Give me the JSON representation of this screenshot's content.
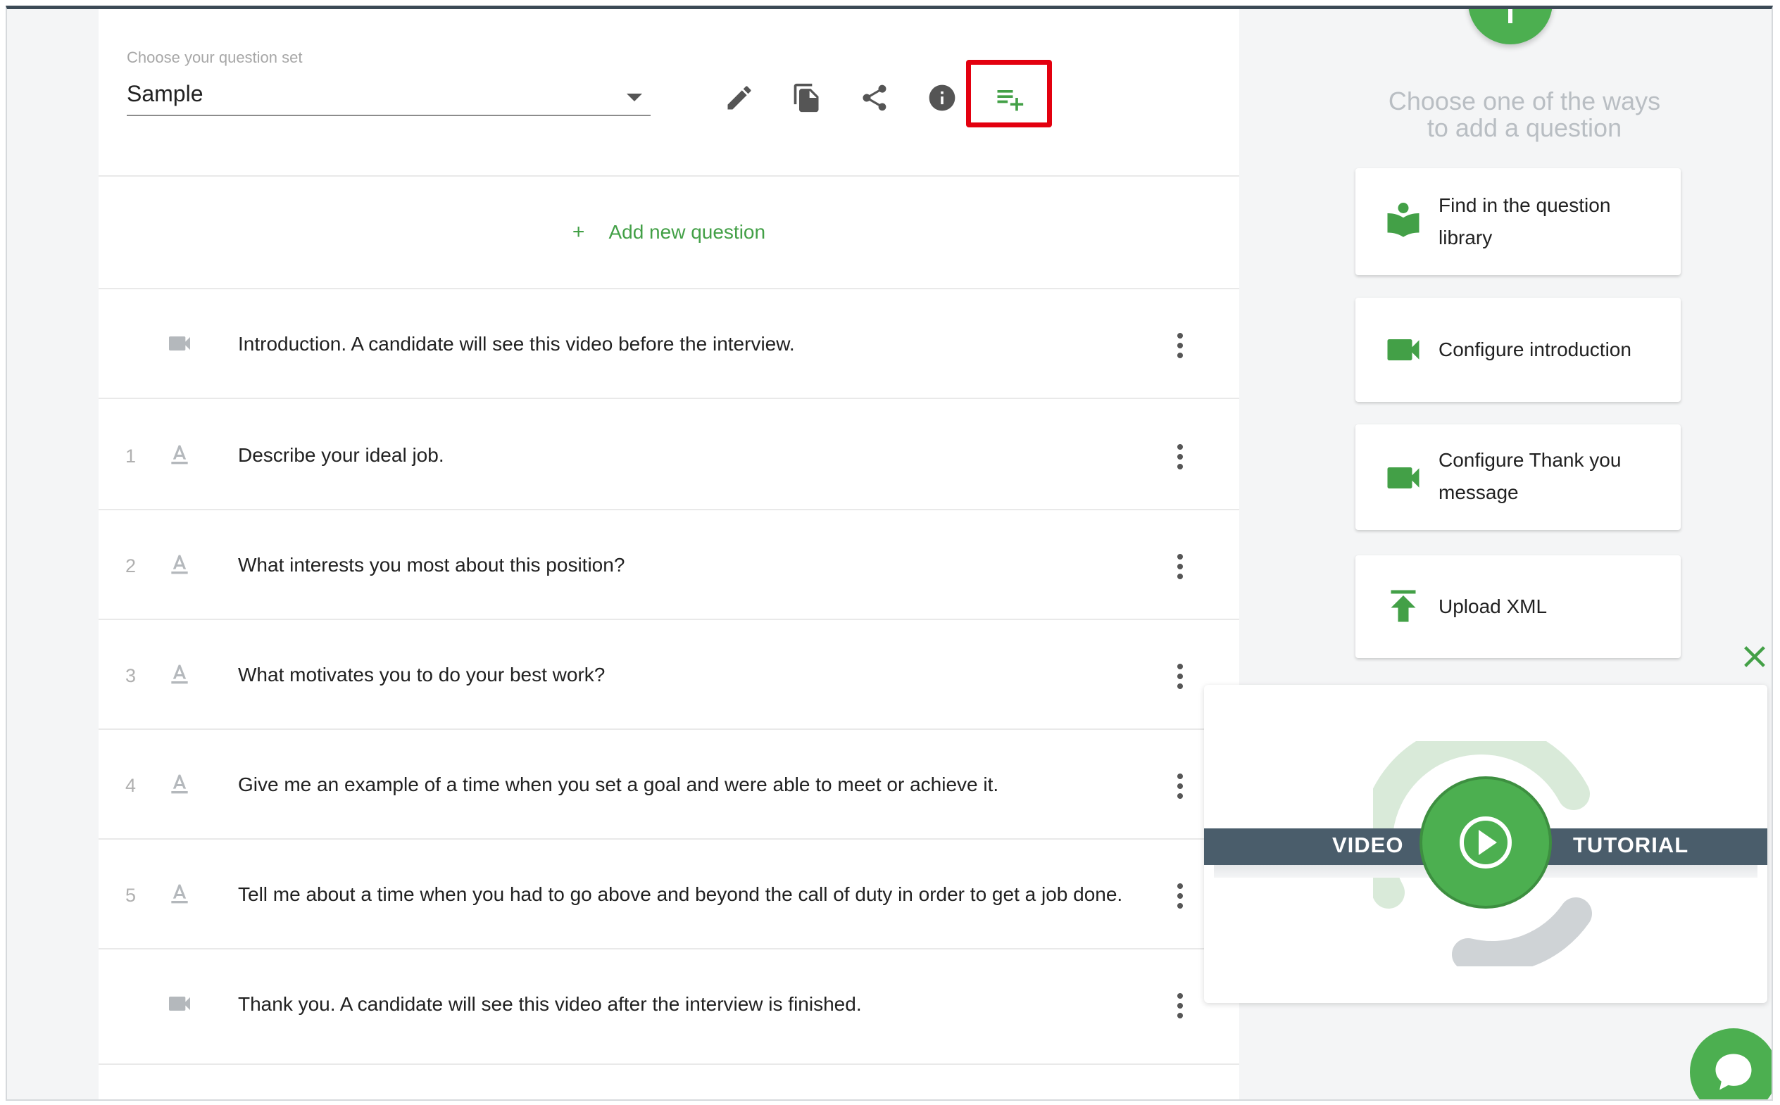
{
  "question_set": {
    "label": "Choose your question set",
    "selected": "Sample"
  },
  "toolbar": {
    "edit_icon": "pencil-icon",
    "copy_icon": "copy-icon",
    "share_icon": "share-icon",
    "info_icon": "info-icon",
    "add_list_icon": "playlist-add-icon"
  },
  "add_question": {
    "plus": "+",
    "label": "Add new question"
  },
  "questions": [
    {
      "num": "",
      "type": "video",
      "text": "Introduction. A candidate will see this video before the interview."
    },
    {
      "num": "1",
      "type": "text",
      "text": "Describe your ideal job."
    },
    {
      "num": "2",
      "type": "text",
      "text": "What interests you most about this position?"
    },
    {
      "num": "3",
      "type": "text",
      "text": "What motivates you to do your best work?"
    },
    {
      "num": "4",
      "type": "text",
      "text": "Give me an example of a time when you set a goal and were able to meet or achieve it."
    },
    {
      "num": "5",
      "type": "text",
      "text": "Tell me about a time when you had to go above and beyond the call of duty in order to get a job done."
    },
    {
      "num": "",
      "type": "video",
      "text": "Thank you. A candidate will see this video after the interview is finished."
    }
  ],
  "right_panel": {
    "title_line1": "Choose one of the ways",
    "title_line2": "to add a question",
    "cards": [
      {
        "line1": "Find in the question",
        "line2": "library",
        "icon": "book-reader-icon"
      },
      {
        "line1": "Configure introduction",
        "line2": "",
        "icon": "video-camera-icon"
      },
      {
        "line1": "Configure Thank you",
        "line2": "message",
        "icon": "video-camera-icon"
      },
      {
        "line1": "Upload XML",
        "line2": "",
        "icon": "upload-icon"
      }
    ]
  },
  "video_tutorial": {
    "left_label": "VIDEO",
    "right_label": "TUTORIAL"
  },
  "colors": {
    "accent": "#43a047",
    "highlight": "#e3000f",
    "banner": "#4a5d6b"
  }
}
